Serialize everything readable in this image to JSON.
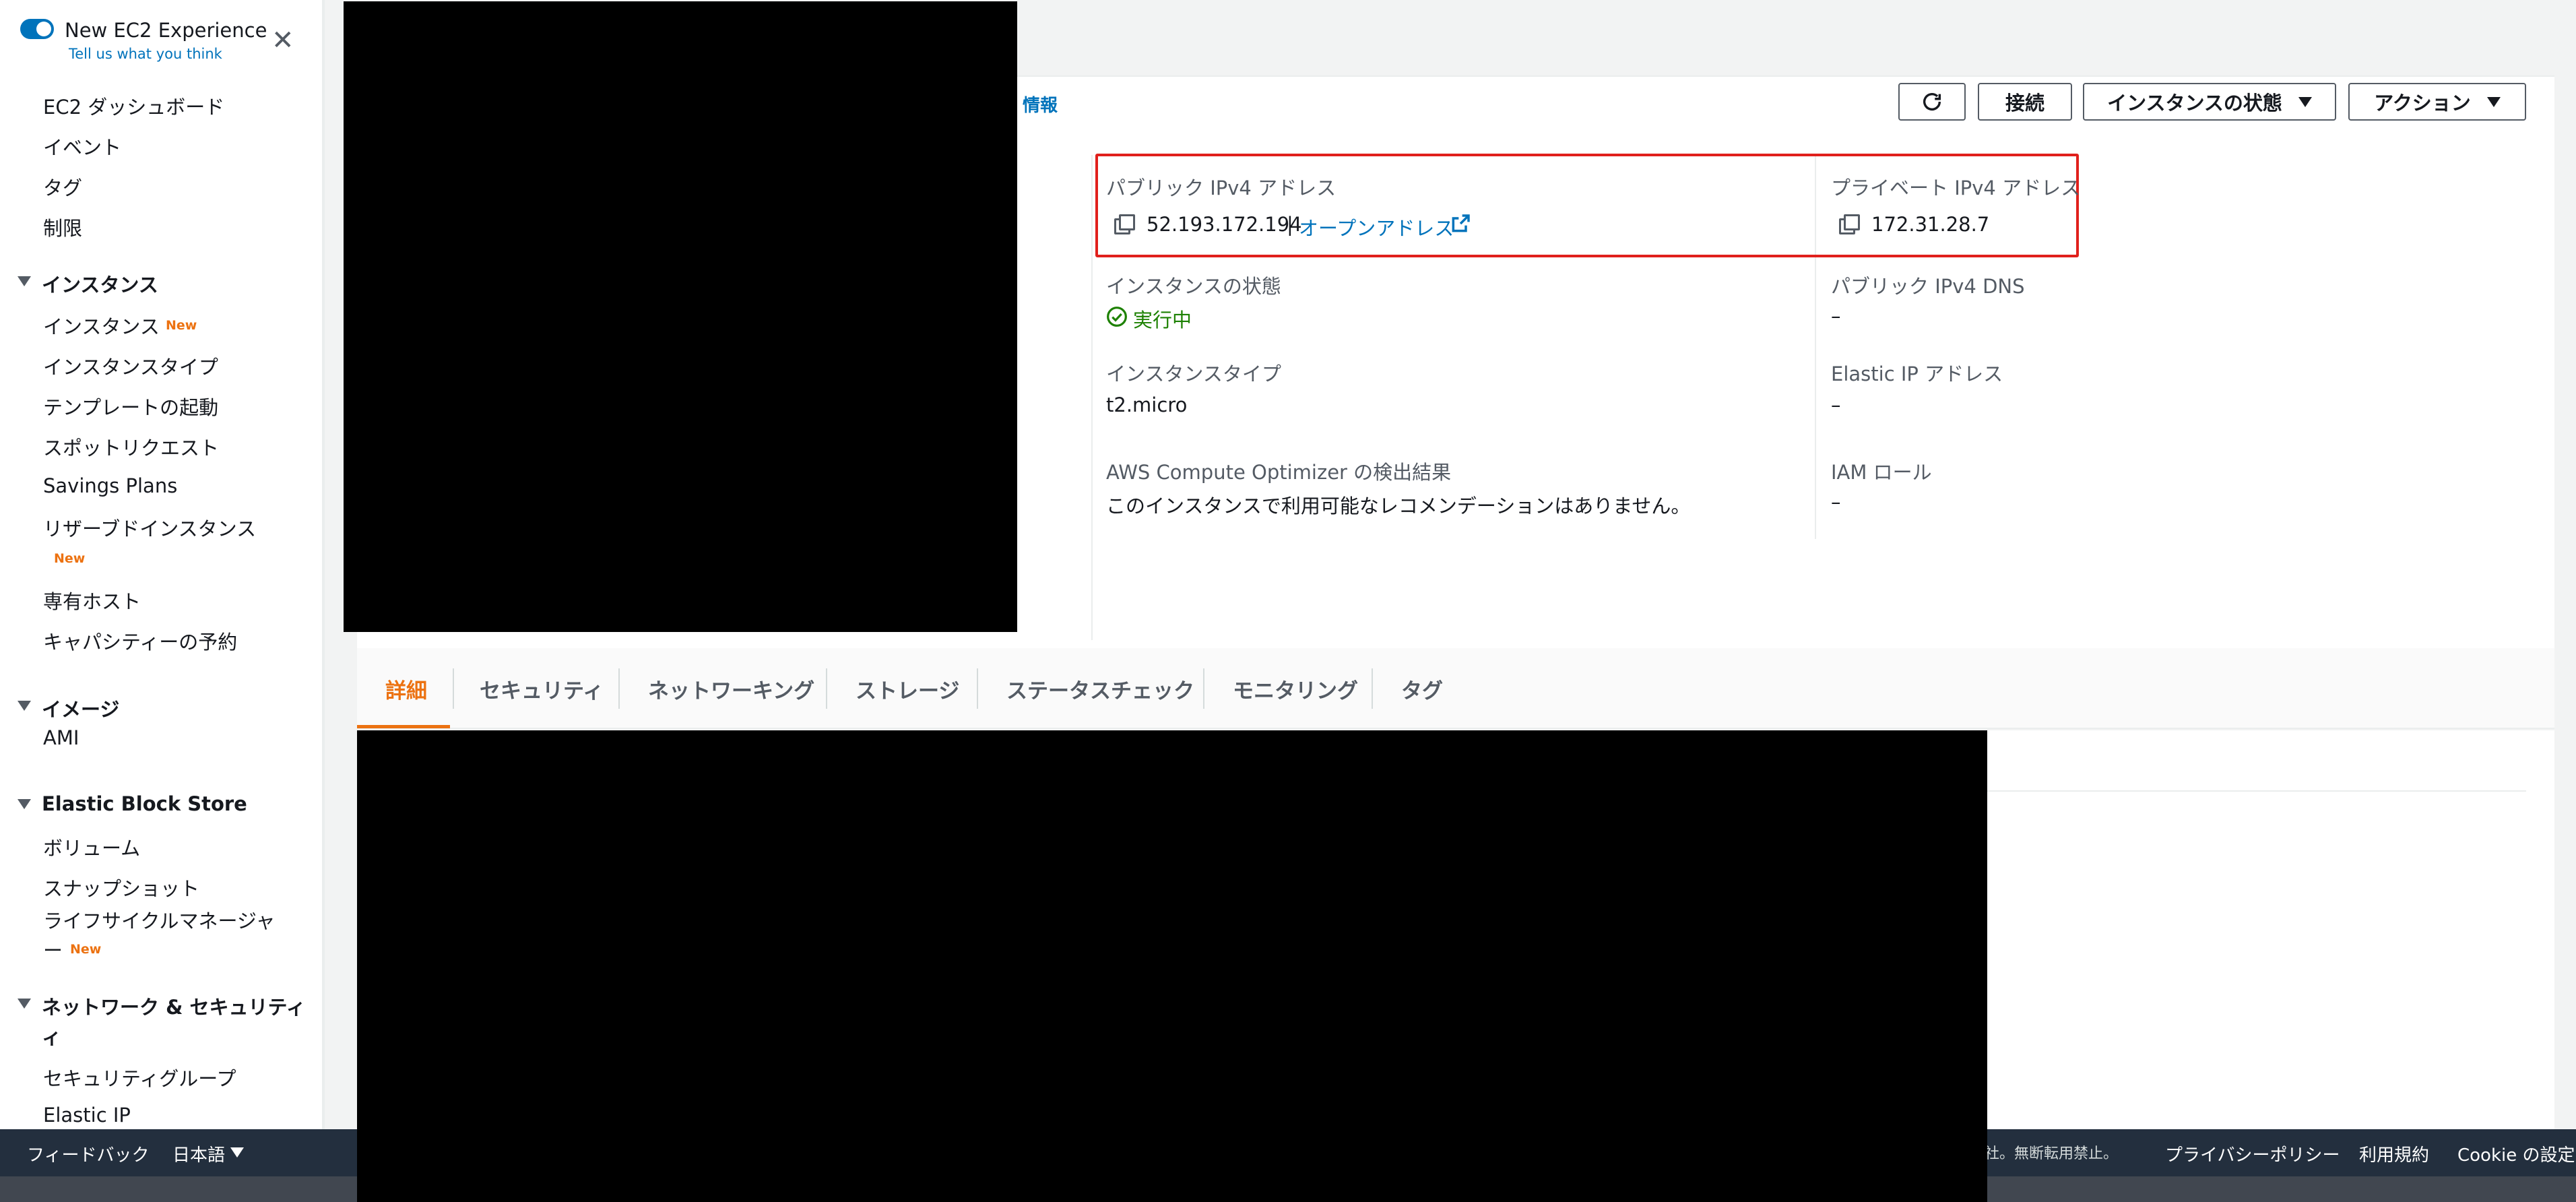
{
  "experience": {
    "title": "New EC2 Experience",
    "feedback_link": "Tell us what you think"
  },
  "sidebar": {
    "top_items": [
      "EC2 ダッシュボード",
      "イベント",
      "タグ",
      "制限"
    ],
    "instances_section": "インスタンス",
    "instances_items": [
      "インスタンス",
      "インスタンスタイプ",
      "テンプレートの起動",
      "スポットリクエスト",
      "Savings Plans",
      "リザーブドインスタンス",
      "専有ホスト",
      "キャパシティーの予約"
    ],
    "new_badge": "New",
    "images_section": "イメージ",
    "images_items": [
      "AMI"
    ],
    "ebs_section": "Elastic Block Store",
    "ebs_items": [
      "ボリューム",
      "スナップショット",
      "ライフサイクルマネージャ",
      "ー"
    ],
    "network_section_line1": "ネットワーク & セキュリティ",
    "network_section_line2": "ィ",
    "network_items": [
      "セキュリティグループ",
      "Elastic IP"
    ]
  },
  "header": {
    "info_link": "情報",
    "connect_button": "接続",
    "instance_state_button": "インスタンスの状態",
    "actions_button": "アクション"
  },
  "summary": {
    "public_ipv4_label": "パブリック IPv4 アドレス",
    "public_ipv4_value": "52.193.172.194",
    "separator": "|",
    "open_address_link": "オープンアドレス",
    "private_ipv4_label": "プライベート IPv4 アドレス",
    "private_ipv4_value": "172.31.28.7",
    "instance_state_label": "インスタンスの状態",
    "instance_state_value": "実行中",
    "public_dns_label": "パブリック IPv4 DNS",
    "public_dns_value": "–",
    "instance_type_label": "インスタンスタイプ",
    "instance_type_value": "t2.micro",
    "elastic_ip_label": "Elastic IP アドレス",
    "elastic_ip_value": "–",
    "optimizer_label": "AWS Compute Optimizer の検出結果",
    "optimizer_value": "このインスタンスで利用可能なレコメンデーションはありません。",
    "iam_role_label": "IAM ロール",
    "iam_role_value": "–"
  },
  "tabs": [
    "詳細",
    "セキュリティ",
    "ネットワーキング",
    "ストレージ",
    "ステータスチェック",
    "モニタリング",
    "タグ"
  ],
  "footer": {
    "feedback": "フィードバック",
    "language": "日本語",
    "copyright": "社。無断転用禁止。",
    "privacy": "プライバシーポリシー",
    "terms": "利用規約",
    "cookie": "Cookie の設定"
  },
  "colors": {
    "accent": "#0073bb",
    "running": "#1d8102",
    "highlight": "#e0201c",
    "active_tab": "#ec7211",
    "new_badge": "#ec7211"
  }
}
